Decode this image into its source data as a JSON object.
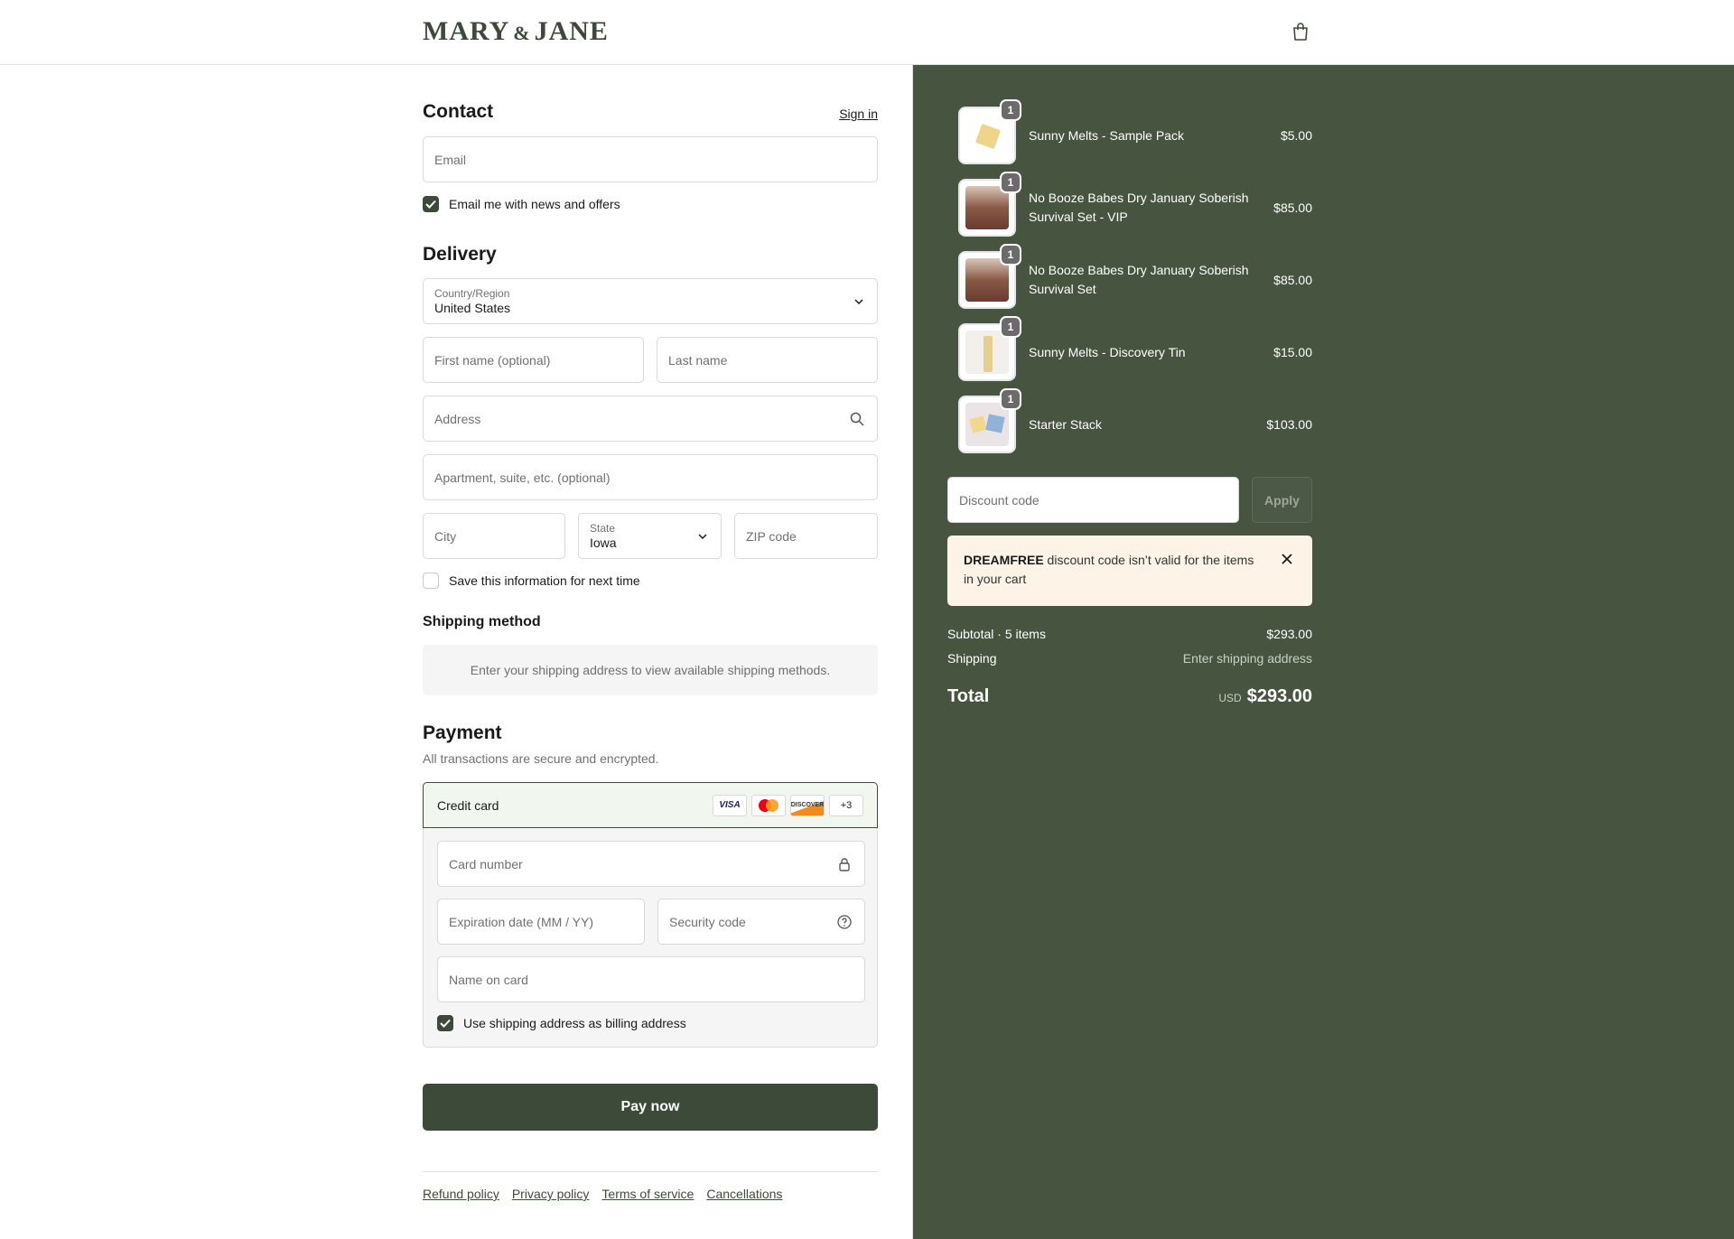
{
  "brand": {
    "name_left": "MARY",
    "amp": "&",
    "name_right": "JANE"
  },
  "contact": {
    "title": "Contact",
    "sign_in": "Sign in",
    "email_placeholder": "Email",
    "news_label": "Email me with news and offers"
  },
  "delivery": {
    "title": "Delivery",
    "country_label": "Country/Region",
    "country_value": "United States",
    "first_name_placeholder": "First name (optional)",
    "last_name_placeholder": "Last name",
    "address_placeholder": "Address",
    "apartment_placeholder": "Apartment, suite, etc. (optional)",
    "city_placeholder": "City",
    "state_label": "State",
    "state_value": "Iowa",
    "zip_placeholder": "ZIP code",
    "save_label": "Save this information for next time"
  },
  "shipping": {
    "title": "Shipping method",
    "message": "Enter your shipping address to view available shipping methods."
  },
  "payment": {
    "title": "Payment",
    "subtitle": "All transactions are secure and encrypted.",
    "method_label": "Credit card",
    "brands": [
      "VISA",
      "MC",
      "DISCOVER",
      "+3"
    ],
    "card_number_placeholder": "Card number",
    "expiration_placeholder": "Expiration date (MM / YY)",
    "security_placeholder": "Security code",
    "name_placeholder": "Name on card",
    "billing_label": "Use shipping address as billing address",
    "pay_button": "Pay now"
  },
  "footer": {
    "links": [
      "Refund policy",
      "Privacy policy",
      "Terms of service",
      "Cancellations"
    ]
  },
  "cart": {
    "items": [
      {
        "name": "Sunny Melts - Sample Pack",
        "price": "$5.00",
        "qty": "1"
      },
      {
        "name": "No Booze Babes Dry January Soberish Survival Set - VIP",
        "price": "$85.00",
        "qty": "1"
      },
      {
        "name": "No Booze Babes Dry January Soberish Survival Set",
        "price": "$85.00",
        "qty": "1"
      },
      {
        "name": "Sunny Melts - Discovery Tin",
        "price": "$15.00",
        "qty": "1"
      },
      {
        "name": "Starter Stack",
        "price": "$103.00",
        "qty": "1"
      }
    ],
    "discount_placeholder": "Discount code",
    "apply_label": "Apply",
    "notice_code": "DREAMFREE",
    "notice_text": " discount code isn’t valid for the items in your cart",
    "subtotal_label": "Subtotal · 5 items",
    "subtotal_value": "$293.00",
    "shipping_label": "Shipping",
    "shipping_value": "Enter shipping address",
    "total_label": "Total",
    "currency": "USD",
    "total_value": "$293.00"
  },
  "colors": {
    "brand_green": "#3d4a39",
    "summary_bg": "#475440",
    "notice_bg": "#fdf4e7"
  }
}
